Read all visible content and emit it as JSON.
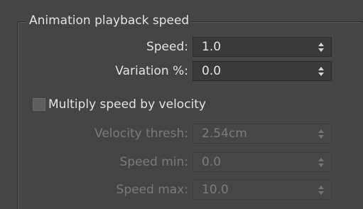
{
  "group": {
    "title": "Animation playback speed"
  },
  "fields": {
    "speed": {
      "label": "Speed:",
      "value": "1.0",
      "enabled": true
    },
    "variation": {
      "label": "Variation %:",
      "value": "0.0",
      "enabled": true
    },
    "velocity_thresh": {
      "label": "Velocity thresh:",
      "value": "2.54cm",
      "enabled": false
    },
    "speed_min": {
      "label": "Speed min:",
      "value": "0.0",
      "enabled": false
    },
    "speed_max": {
      "label": "Speed max:",
      "value": "10.0",
      "enabled": false
    }
  },
  "multiply_checkbox": {
    "label": "Multiply speed by velocity",
    "checked": false
  },
  "colors": {
    "background": "#454545",
    "text": "#e2e2e2",
    "disabled_text": "#7a7a7a",
    "field_bg": "#3a3a3a"
  }
}
